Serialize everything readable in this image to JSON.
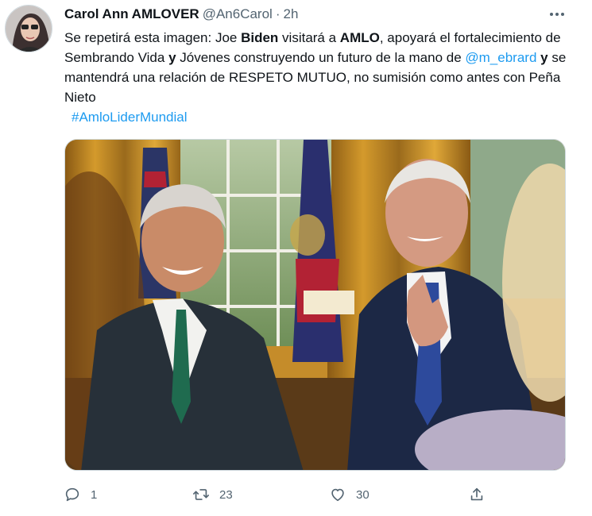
{
  "tweet": {
    "author_name": "Carol Ann AMLOVER",
    "author_handle": "@An6Carol",
    "separator": "·",
    "time": "2h",
    "text": {
      "p1": "Se repetirá esta imagen: Joe ",
      "b1": "Biden",
      "p2": " visitará a ",
      "b2": "AMLO",
      "p3": ", apoyará el fortalecimiento de Sembrando Vida ",
      "b3": "y",
      "p4": " Jóvenes construyendo un futuro de la mano de ",
      "mention": "@m_ebrard",
      "p5": " ",
      "b4": "y",
      "p6": " se mantendrá una relación de RESPETO MUTUO, no sumisión como antes con Peña Nieto"
    },
    "hashtag": "#AmloLiderMundial",
    "actions": {
      "reply_count": "1",
      "retweet_count": "23",
      "like_count": "30"
    }
  },
  "colors": {
    "link": "#1d9bf0",
    "secondary_text": "#536471",
    "primary_text": "#0f1419"
  },
  "icons": [
    "avatar",
    "more-icon",
    "reply-icon",
    "retweet-icon",
    "like-icon",
    "share-icon"
  ]
}
